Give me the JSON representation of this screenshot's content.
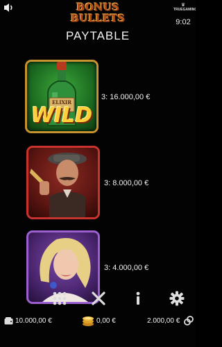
{
  "header": {
    "game_title": "BONUS BULLETS",
    "brand_name": "TRUEGAMING",
    "time": "9:02",
    "icons": {
      "sound": "speaker-icon",
      "brand": "crown-logo-icon"
    }
  },
  "paytable": {
    "title": "PAYTABLE",
    "symbols": [
      {
        "symbol": "wild-whiskey-bottle",
        "wild_label": "WILD",
        "bottle_label": "ELIXIR",
        "payout": "3: 16.000,00 €"
      },
      {
        "symbol": "gangster-with-revolver",
        "payout": "3: 8.000,00 €"
      },
      {
        "symbol": "blonde-lady",
        "payout": "3: 4.000,00 €"
      }
    ]
  },
  "controls": {
    "menu_icon": "grid-menu-icon",
    "close_icon": "close-icon",
    "info_icon": "info-icon",
    "settings_icon": "gear-icon"
  },
  "footer": {
    "balance": "10.000,00 €",
    "win": "0,00 €",
    "bet": "2.000,00 €",
    "icons": {
      "balance": "wallet-icon",
      "win": "coins-icon",
      "bet": "chips-icon"
    }
  },
  "colors": {
    "background": "#030303",
    "wild_frame": "#c8922f",
    "gangster_frame": "#c9332e",
    "lady_frame": "#9b5fd0",
    "title_gold": "#b54a1a"
  }
}
